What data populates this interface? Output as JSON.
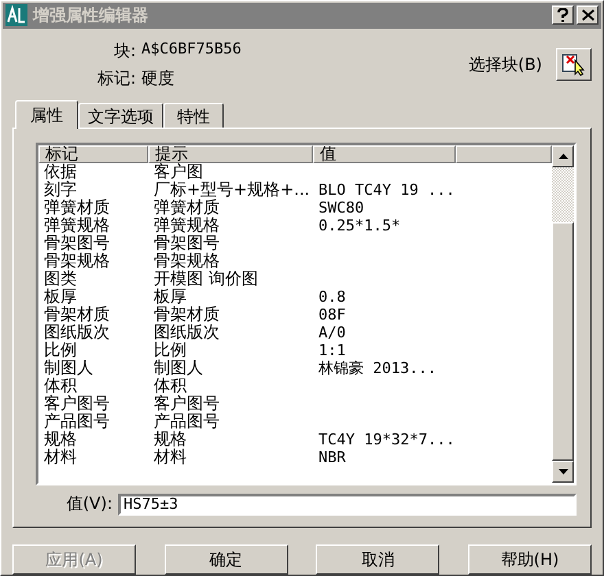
{
  "window": {
    "title": "增强属性编辑器"
  },
  "block": {
    "label": "块:",
    "value": "A$C6BF75B56"
  },
  "tag": {
    "label": "标记:",
    "value": "硬度"
  },
  "select_block": {
    "label": "选择块(B)"
  },
  "tabs": [
    {
      "label": "属性",
      "selected": true
    },
    {
      "label": "文字选项",
      "selected": false
    },
    {
      "label": "特性",
      "selected": false
    }
  ],
  "table": {
    "columns": [
      "标记",
      "提示",
      "值"
    ],
    "rows": [
      {
        "tag": "依据",
        "prompt": "客户图"
      },
      {
        "tag": "刻字",
        "prompt": "厂标+型号+规格+...",
        "value": "BLO TC4Y 19 ..."
      },
      {
        "tag": "弹簧材质",
        "prompt": "弹簧材质",
        "value": "SWC80"
      },
      {
        "tag": "弹簧规格",
        "prompt": "弹簧规格",
        "value": "0.25*1.5*"
      },
      {
        "tag": "骨架图号",
        "prompt": "骨架图号"
      },
      {
        "tag": "骨架规格",
        "prompt": "骨架规格"
      },
      {
        "tag": "图类",
        "prompt": "开模图 询价图"
      },
      {
        "tag": "板厚",
        "prompt": "板厚",
        "value": "0.8"
      },
      {
        "tag": "骨架材质",
        "prompt": "骨架材质",
        "value": "08F"
      },
      {
        "tag": "图纸版次",
        "prompt": "图纸版次",
        "value": "A/0"
      },
      {
        "tag": "比例",
        "prompt": "比例",
        "value": "1:1"
      },
      {
        "tag": "制图人",
        "prompt": "制图人",
        "value": "林锦豪  2013..."
      },
      {
        "tag": "体积",
        "prompt": "体积"
      },
      {
        "tag": "客户图号",
        "prompt": "客户图号"
      },
      {
        "tag": "产品图号",
        "prompt": "产品图号"
      },
      {
        "tag": "规格",
        "prompt": "规格",
        "value": "TC4Y 19*32*7..."
      },
      {
        "tag": "材料",
        "prompt": "材料",
        "value": "NBR"
      }
    ]
  },
  "value_field": {
    "label": "值(V):",
    "value": "HS75±3"
  },
  "buttons": [
    {
      "label": "应用(A)",
      "disabled": true
    },
    {
      "label": "确定",
      "disabled": false
    },
    {
      "label": "取消",
      "disabled": false
    },
    {
      "label": "帮助(H)",
      "disabled": false
    }
  ]
}
